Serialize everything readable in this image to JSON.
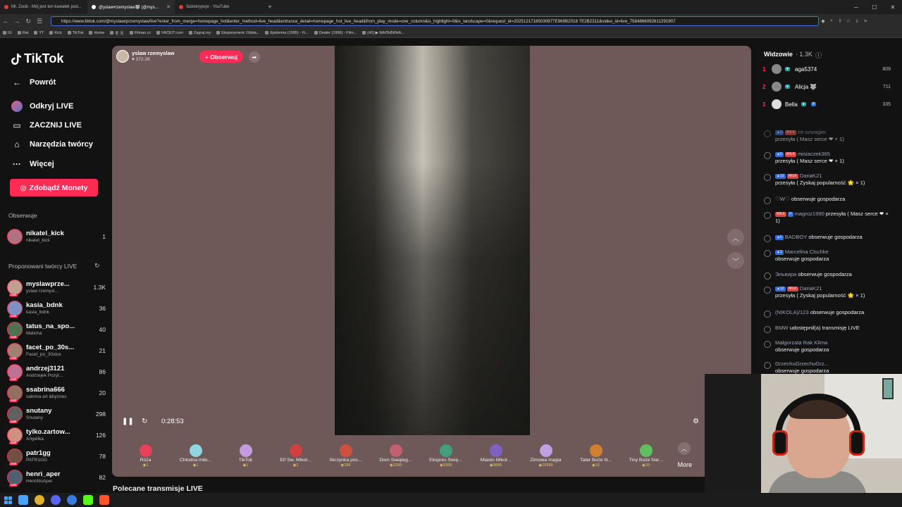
{
  "browser": {
    "tabs": [
      {
        "title": "Mr. Zoob - Mój jest ten kawałek pod...",
        "color": "#e03c3c"
      },
      {
        "title": "@yslaw•rzemyslaw🐺 (@mys...",
        "color": "#ffffff"
      },
      {
        "title": "Subskrypcje - YouTube",
        "color": "#e03c3c"
      }
    ],
    "url": "https://www.tiktok.com/@myslawrprzemyslaw/live?enter_from_merge=homepage_hot&enter_method=live_head&entrance_detail=homepage_hot_live_head&from_play_mode=one_column&is_highlight=0&is_landscape=0&request_id=20251217165030877E969B2018 7E2B2311&video_id=live_7584866092611291907",
    "bookmarks": [
      "IG",
      "Rat",
      "YT",
      "Kick",
      "TikTok",
      "Home",
      "冬 天",
      "Filman.cc",
      "FACEIT.com",
      "Zagraj.my",
      "Eksperyment: Odsła...",
      "Epidemia (1995) - Fi...",
      "Dealer (1996) - Film...",
      "(42) ▶ МАЛЬВИНА..."
    ]
  },
  "sidebar": {
    "logo": "TikTok",
    "nav": [
      {
        "label": "Powrót",
        "icon": "arrow-left-icon"
      },
      {
        "label": "Odkryj LIVE",
        "icon": "live-discover-icon"
      },
      {
        "label": "ZACZNIJ LIVE",
        "icon": "camera-icon"
      },
      {
        "label": "Narzędzia twórcy",
        "icon": "lightbulb-icon"
      },
      {
        "label": "Więcej",
        "icon": "more-icon"
      }
    ],
    "coins_button": "Zdobądź Monety",
    "following_title": "Obserwuje",
    "following": [
      {
        "name": "nikatel_kick",
        "sub": "nikatel_kick",
        "count": "1"
      }
    ],
    "suggested_title": "Proponowani twórcy LIVE",
    "suggested": [
      {
        "name": "myslawprze...",
        "sub": "yslaw rzemysl...",
        "count": "1.3K"
      },
      {
        "name": "kasia_bdnk",
        "sub": "kasia_bdnk",
        "count": "36"
      },
      {
        "name": "tatus_na_spo...",
        "sub": "Malicha",
        "count": "40"
      },
      {
        "name": "facet_po_30s...",
        "sub": "Facet_po_30stce",
        "count": "21"
      },
      {
        "name": "andrzej3121",
        "sub": "Andrzejek Pozyt...",
        "count": "86"
      },
      {
        "name": "ssabrina666",
        "sub": "sabrina art &byznes",
        "count": "20"
      },
      {
        "name": "snutany",
        "sub": "Snutany",
        "count": "298"
      },
      {
        "name": "tylko.zartow...",
        "sub": "Angelika",
        "count": "126"
      },
      {
        "name": "patr1gg",
        "sub": "PATR1GG",
        "count": "78"
      },
      {
        "name": "henri_aper",
        "sub": "HenriNoAper",
        "count": "82"
      }
    ]
  },
  "stream": {
    "streamer_name": "yslaw rzemyslaw",
    "viewers": "372.2K",
    "follow_label": "+ Obserwuj",
    "time": "0:28:53",
    "gifts": [
      {
        "name": "Róża",
        "price": "1",
        "color": "#e8405a"
      },
      {
        "name": "Chłodna miło...",
        "price": "1",
        "color": "#8fd6e0"
      },
      {
        "name": "TikTok",
        "price": "1",
        "color": "#c49ae0"
      },
      {
        "name": "Elf Św. Mikoł...",
        "price": "1",
        "color": "#d04040"
      },
      {
        "name": "Skrzynka poc...",
        "price": "199",
        "color": "#d05040"
      },
      {
        "name": "Dom Świąteg...",
        "price": "2200",
        "color": "#c06070"
      },
      {
        "name": "Ekspres Świę...",
        "price": "5999",
        "color": "#40a080"
      },
      {
        "name": "Miasto Mikoł...",
        "price": "9999",
        "color": "#8060c0"
      },
      {
        "name": "Zimowa magia",
        "price": "19999",
        "color": "#c0a0e0"
      },
      {
        "name": "Tater Boże N...",
        "price": "10",
        "color": "#d08030"
      },
      {
        "name": "Tiny Boże Nar...",
        "price": "10",
        "color": "#60c060"
      }
    ],
    "more_label": "More",
    "recommended_label": "Polecane transmisje LIVE"
  },
  "chat": {
    "viewers_title": "Widzowie",
    "viewers_count": "· 1.3K",
    "top": [
      {
        "rank": "1",
        "name": "aga5374",
        "points": "809"
      },
      {
        "rank": "2",
        "name": "Alicja 🐺",
        "points": "711"
      },
      {
        "rank": "3",
        "name": "Bella",
        "points": "335"
      }
    ],
    "messages": [
      {
        "who": "mr.szwagier",
        "text": "przesyła ( Masz serce ❤ × 1)"
      },
      {
        "who": "misiaczek365",
        "text": "przesyła ( Masz serce ❤ × 1)"
      },
      {
        "who": "DariaK21",
        "text": "przesyła ( Zyskaj popularność 🌟 × 1)"
      },
      {
        "who": "♡W♡",
        "text": "obserwuje gospodarza"
      },
      {
        "who": "magroz1990",
        "text": "przesyła ( Masz serce ❤ × 1)"
      },
      {
        "who": "BADBOY",
        "text": "obserwuje gospodarza"
      },
      {
        "who": "Marcelina Cischke",
        "text": "obserwuje gospodarza"
      },
      {
        "who": "Эльвира",
        "text": "obserwuje gospodarza"
      },
      {
        "who": "DariaK21",
        "text": "przesyła ( Zyskaj popularność 🌟 × 1)"
      },
      {
        "who": "(NIKOLA)/123",
        "text": "obserwuje gospodarza"
      },
      {
        "who": "BMW",
        "text": "udostępnił(a) transmisję LIVE"
      },
      {
        "who": "Małgorzata Rak Klima",
        "text": "obserwuje gospodarza"
      },
      {
        "who": "GrzechuGrzechuGrz...",
        "text": "obserwuje gospodarza"
      }
    ]
  }
}
